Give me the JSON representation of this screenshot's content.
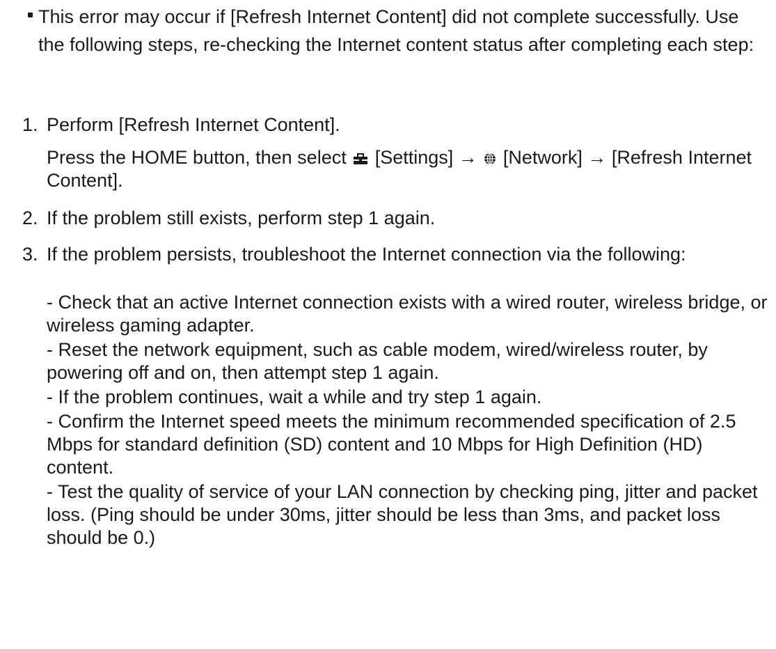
{
  "intro": {
    "text": "This error may occur if [Refresh Internet Content] did not complete successfully. Use the following steps, re-checking the Internet content status after completing each step:"
  },
  "steps": [
    {
      "number": "1.",
      "title": "Perform [Refresh Internet Content].",
      "detail_pre": "Press the HOME button, then select",
      "settings_label": "[Settings] →",
      "network_label": "[Network] →",
      "detail_post": "[Refresh Internet Content]."
    },
    {
      "number": "2.",
      "title": "If the problem still exists, perform step 1 again."
    },
    {
      "number": "3.",
      "title": "If the problem persists, troubleshoot the Internet connection via the following:",
      "items": [
        "- Check that an active Internet connection exists with a wired router, wireless bridge, or wireless gaming adapter.",
        "- Reset the network equipment, such as cable modem, wired/wireless router, by powering off and on, then attempt step 1 again.",
        "- If the problem continues, wait a while and try step 1 again.",
        "- Confirm the Internet speed meets the minimum recommended specification of 2.5 Mbps for standard definition (SD) content and 10 Mbps for High Definition (HD) content.",
        "- Test the quality of service of your LAN connection by checking ping, jitter and packet loss. (Ping should be under 30ms, jitter should be less than 3ms, and packet loss should be 0.)"
      ]
    }
  ],
  "icons": {
    "settings": "toolbox-icon",
    "network": "globe-icon"
  }
}
